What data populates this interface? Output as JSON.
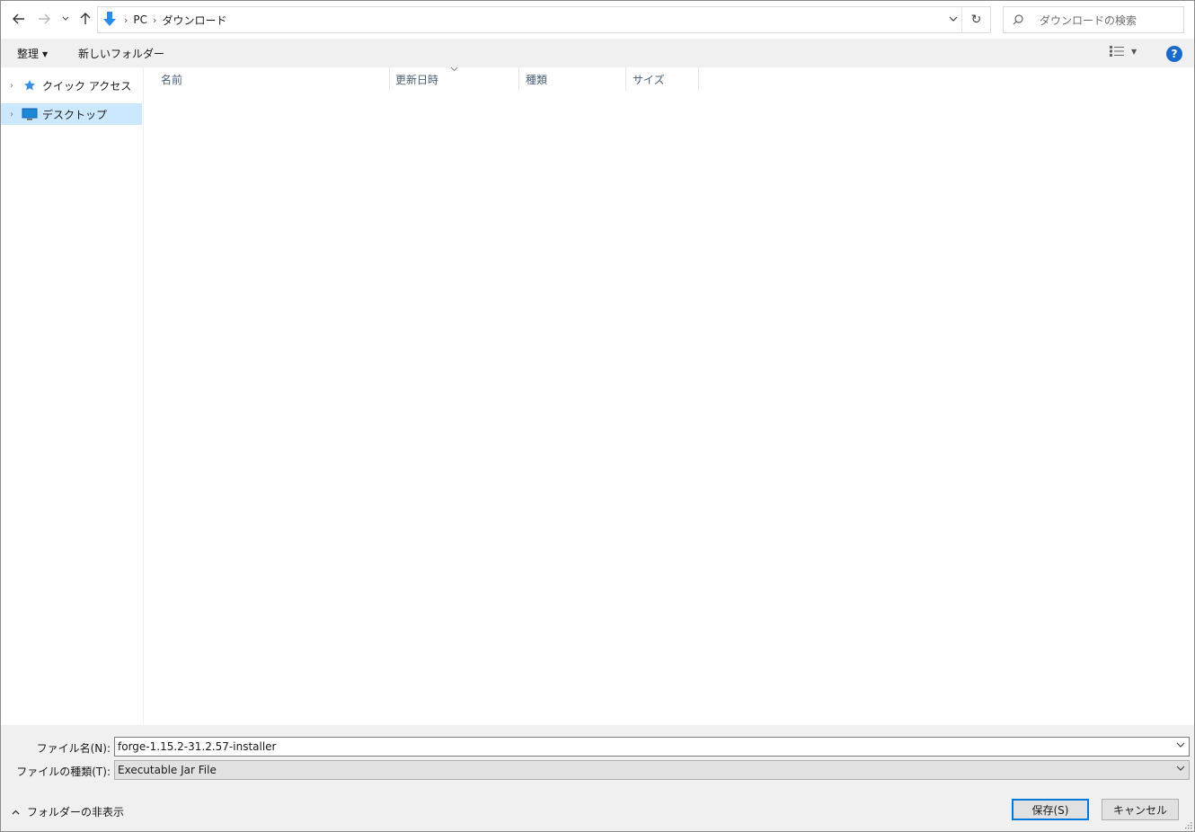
{
  "address_bar": {
    "breadcrumbs": [
      "PC",
      "ダウンロード"
    ],
    "search_placeholder": "ダウンロードの検索"
  },
  "toolbar": {
    "organize_label": "整理",
    "new_folder_label": "新しいフォルダー",
    "help_label": "?"
  },
  "nav_pane": {
    "items": [
      {
        "label": "クイック アクセス",
        "icon": "star-icon",
        "selected": false
      },
      {
        "label": "デスクトップ",
        "icon": "desktop-icon",
        "selected": true
      }
    ]
  },
  "file_list": {
    "columns": [
      "名前",
      "更新日時",
      "種類",
      "サイズ"
    ]
  },
  "bottom": {
    "filename_label": "ファイル名(N):",
    "filename_value": "forge-1.15.2-31.2.57-installer",
    "filetype_label": "ファイルの種類(T):",
    "filetype_value": "Executable Jar File",
    "hide_folders_label": "フォルダーの非表示",
    "save_label": "保存(S)",
    "cancel_label": "キャンセル"
  },
  "colors": {
    "accent": "#0078d7",
    "selection": "#cce8ff",
    "chrome": "#f0f0f0",
    "folder_arrow": "#2e8ae6"
  }
}
